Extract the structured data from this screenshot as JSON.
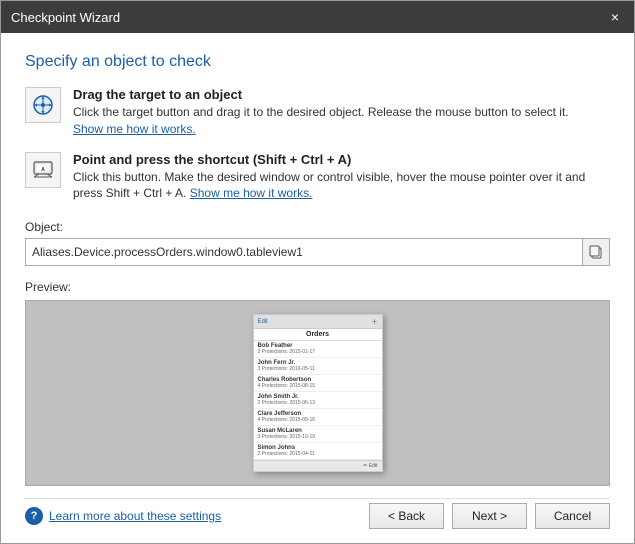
{
  "window": {
    "title": "Checkpoint Wizard",
    "close_label": "×"
  },
  "page": {
    "title": "Specify an object to check"
  },
  "instructions": [
    {
      "id": "drag",
      "icon": "drag-target-icon",
      "title": "Drag the target to an object",
      "description": "Click the target button and drag it to the desired object. Release the mouse button to select it.",
      "link_text": "Show me how it works."
    },
    {
      "id": "shortcut",
      "icon": "shortcut-icon",
      "title": "Point and press the shortcut (Shift + Ctrl + A)",
      "description": "Click this button. Make the desired window or control visible, hover the mouse pointer over it and press Shift + Ctrl + A.",
      "link_text": "Show me how it works."
    }
  ],
  "object_field": {
    "label": "Object:",
    "value": "Aliases.Device.processOrders.window0.tableview1",
    "button_icon": "copy-icon"
  },
  "preview": {
    "label": "Preview:",
    "toolbar_text": "Edit",
    "header": "Orders",
    "items": [
      {
        "name": "Bob Feather",
        "detail": "2 Protections: 2015-01-17"
      },
      {
        "name": "John Fern Jr.",
        "detail": "3 Protections: 2016-05-11"
      },
      {
        "name": "Charles Robertson",
        "detail": "4 Protections: 2015-08-15"
      },
      {
        "name": "John Smith Jr.",
        "detail": "2 Protections: 2015-06-13"
      },
      {
        "name": "Clare Jefferson",
        "detail": "4 Protections: 2015-09-16"
      },
      {
        "name": "Susan McLaren",
        "detail": "3 Protections: 2015-10-19"
      },
      {
        "name": "Simon Johns",
        "detail": "2 Protections: 2015-04-11"
      }
    ],
    "footer_text": "✏ Edit"
  },
  "bottom": {
    "help_link": "Learn more about these settings"
  },
  "buttons": {
    "back": "< Back",
    "next": "Next >",
    "cancel": "Cancel"
  }
}
